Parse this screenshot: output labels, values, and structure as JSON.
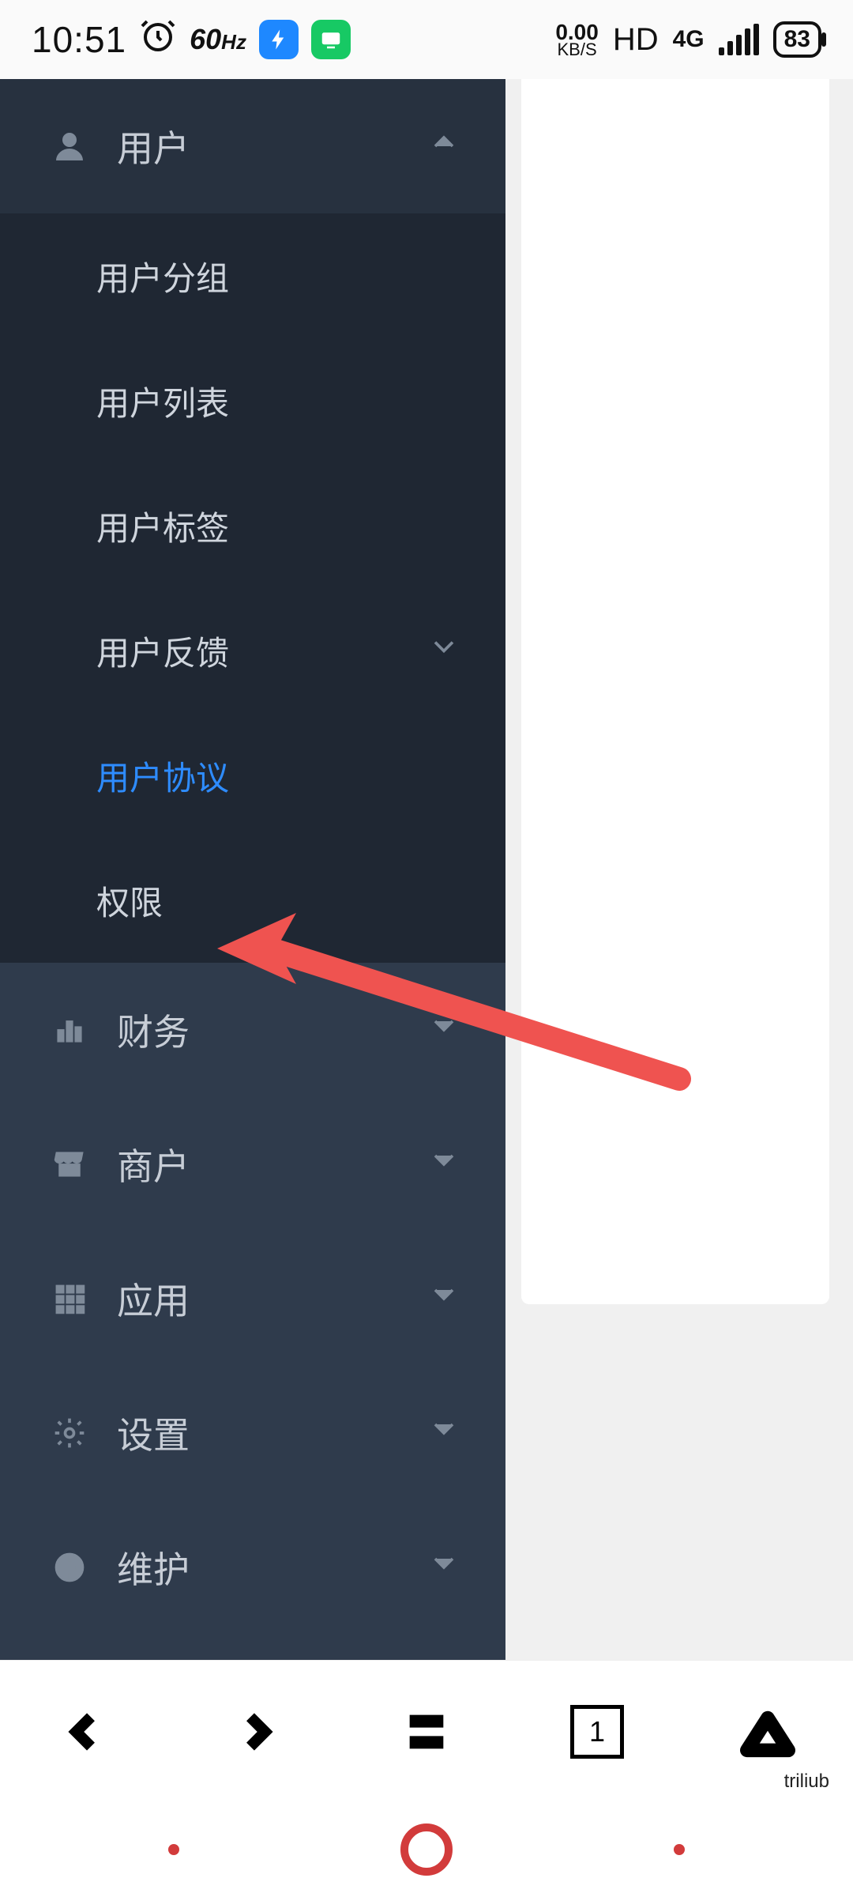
{
  "status": {
    "time": "10:51",
    "refresh_rate": "60",
    "refresh_unit": "Hz",
    "net_speed_value": "0.00",
    "net_speed_unit": "KB/S",
    "hd": "HD",
    "net_gen": "4G",
    "battery": "83"
  },
  "sidebar": {
    "user_section": {
      "label": "用户",
      "expanded": true,
      "items": [
        {
          "label": "用户分组"
        },
        {
          "label": "用户列表"
        },
        {
          "label": "用户标签"
        },
        {
          "label": "用户反馈",
          "has_children": true
        },
        {
          "label": "用户协议",
          "active": true
        },
        {
          "label": "权限"
        }
      ]
    },
    "sections": [
      {
        "label": "财务"
      },
      {
        "label": "商户"
      },
      {
        "label": "应用"
      },
      {
        "label": "设置"
      },
      {
        "label": "维护"
      }
    ]
  },
  "browser": {
    "tab_count": "1"
  },
  "watermark": "triliub"
}
